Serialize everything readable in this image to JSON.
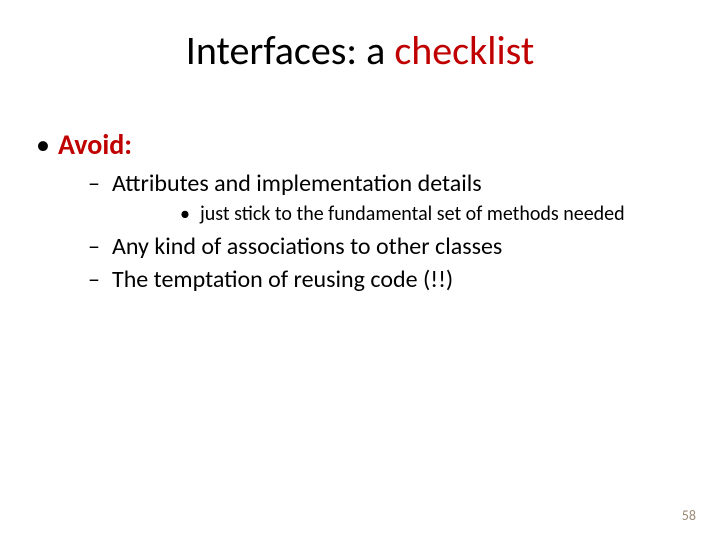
{
  "title_plain": "Interfaces: a ",
  "title_accent": "checklist",
  "avoid_label": "Avoid:",
  "bullets": {
    "b1": "Attributes and implementation details",
    "b1a": "just stick to the fundamental set of methods needed",
    "b2": "Any kind of associations to other classes",
    "b3": "The temptation of reusing code (!!)"
  },
  "page_number": "58"
}
